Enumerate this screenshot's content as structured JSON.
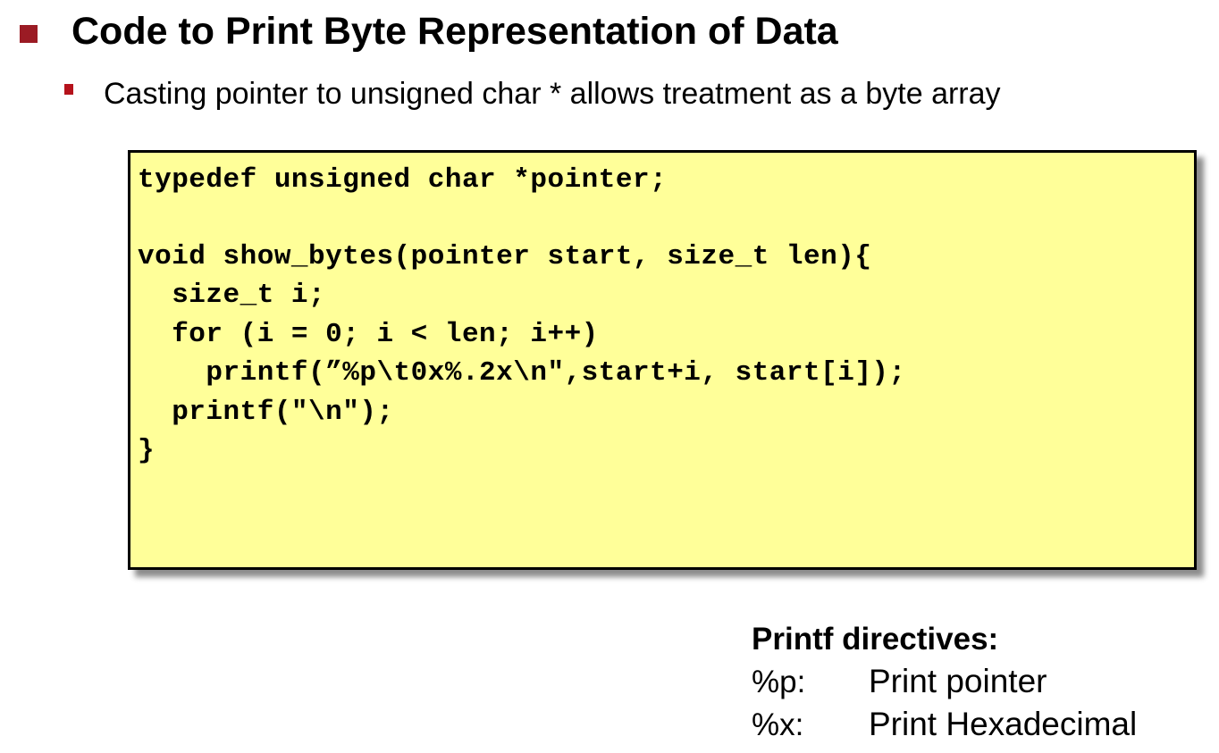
{
  "heading": {
    "title": "Code to Print Byte Representation of Data",
    "subtitle": "Casting pointer to unsigned char * allows treatment as a byte array"
  },
  "code": {
    "lines": [
      "typedef unsigned char *pointer;",
      "void show_bytes(pointer start, size_t len){",
      "  size_t i;",
      "  for (i = 0; i < len; i++)",
      "    printf(”%p\\t0x%.2x\\n\",start+i, start[i]);",
      "  printf(\"\\n\");",
      "}"
    ]
  },
  "directives": {
    "title": "Printf directives:",
    "items": [
      {
        "key": "%p:",
        "desc": "Print pointer"
      },
      {
        "key": "%x:",
        "desc": "Print Hexadecimal"
      }
    ]
  },
  "colors": {
    "bullet_main": "#9b1b24",
    "bullet_sub": "#b5121b",
    "code_background": "#ffff99"
  }
}
